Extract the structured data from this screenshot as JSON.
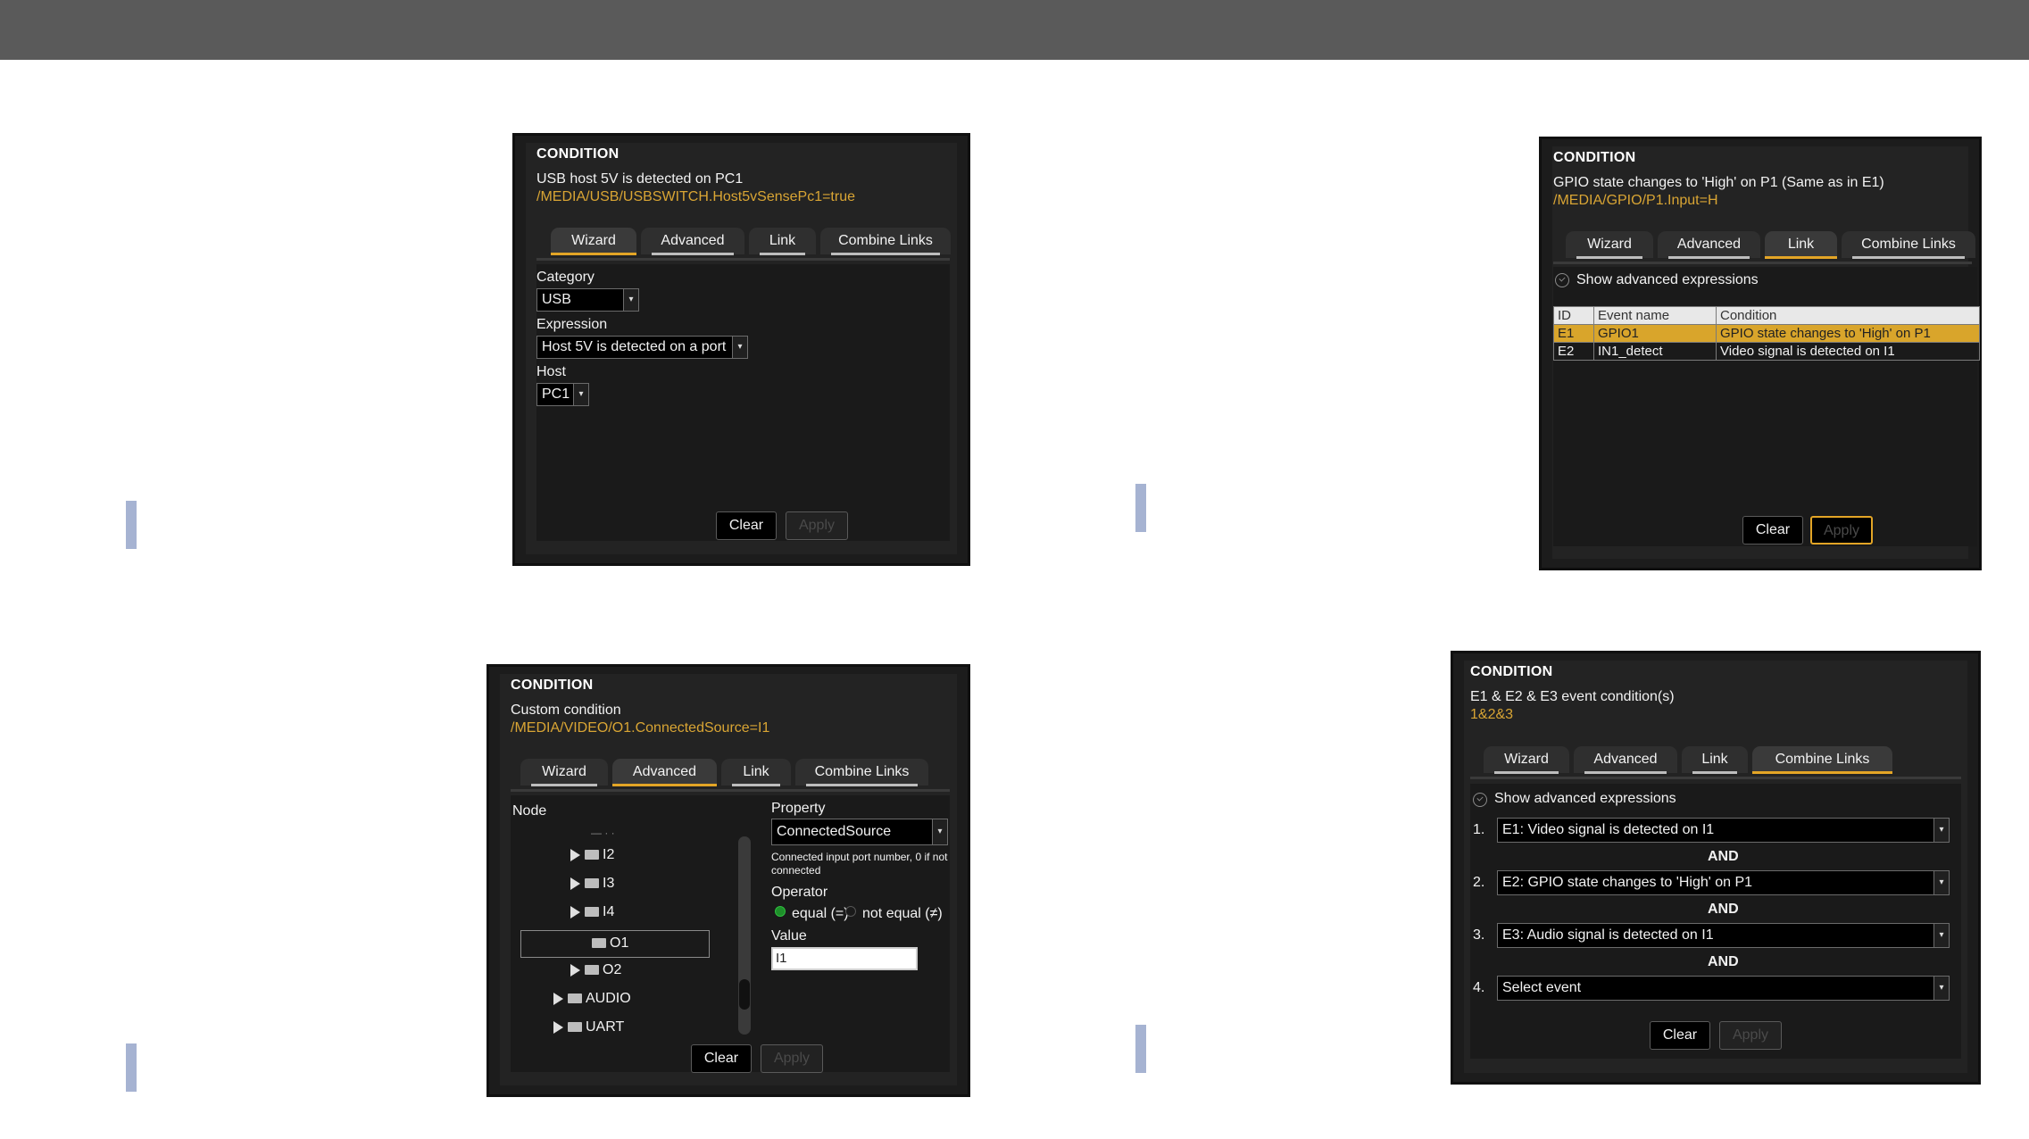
{
  "tabs": [
    "Wizard",
    "Advanced",
    "Link",
    "Combine Links"
  ],
  "clear": "Clear",
  "apply": "Apply",
  "panel1": {
    "title": "CONDITION",
    "desc": "USB host 5V is detected on PC1",
    "path": "/MEDIA/USB/USBSWITCH.Host5vSensePc1=true",
    "active_tab": "Wizard",
    "category_label": "Category",
    "category_value": "USB",
    "expression_label": "Expression",
    "expression_value": "Host 5V is detected on a port",
    "host_label": "Host",
    "host_value": "PC1"
  },
  "panel2": {
    "title": "CONDITION",
    "desc": "GPIO state changes to 'High' on P1 (Same as in E1)",
    "path": "/MEDIA/GPIO/P1.Input=H",
    "active_tab": "Link",
    "show_adv": "Show advanced expressions",
    "headers": [
      "ID",
      "Event name",
      "Condition"
    ],
    "rows": [
      {
        "id": "E1",
        "name": "GPIO1",
        "cond": "GPIO state changes to 'High' on P1",
        "highlight": true
      },
      {
        "id": "E2",
        "name": "IN1_detect",
        "cond": "Video signal is detected on I1",
        "highlight": false
      }
    ]
  },
  "panel3": {
    "title": "CONDITION",
    "desc": "Custom condition",
    "path": "/MEDIA/VIDEO/O1.ConnectedSource=I1",
    "active_tab": "Advanced",
    "node_label": "Node",
    "tree": [
      "I2",
      "I3",
      "I4",
      "O1",
      "O2",
      "AUDIO",
      "UART"
    ],
    "property_label": "Property",
    "property_value": "ConnectedSource",
    "property_desc": "Connected input port number, 0 if not connected",
    "operator_label": "Operator",
    "op_equal": "equal (=)",
    "op_not_equal": "not equal (≠)",
    "value_label": "Value",
    "value": "I1"
  },
  "panel4": {
    "title": "CONDITION",
    "desc": "E1 & E2 & E3 event condition(s)",
    "path": "1&2&3",
    "active_tab": "Combine Links",
    "show_adv": "Show advanced expressions",
    "and_label": "AND",
    "items": [
      {
        "num": "1.",
        "value": "E1: Video signal is detected on I1"
      },
      {
        "num": "2.",
        "value": "E2: GPIO state changes to 'High' on P1"
      },
      {
        "num": "3.",
        "value": "E3: Audio signal is detected on I1"
      },
      {
        "num": "4.",
        "value": "Select event"
      }
    ]
  }
}
